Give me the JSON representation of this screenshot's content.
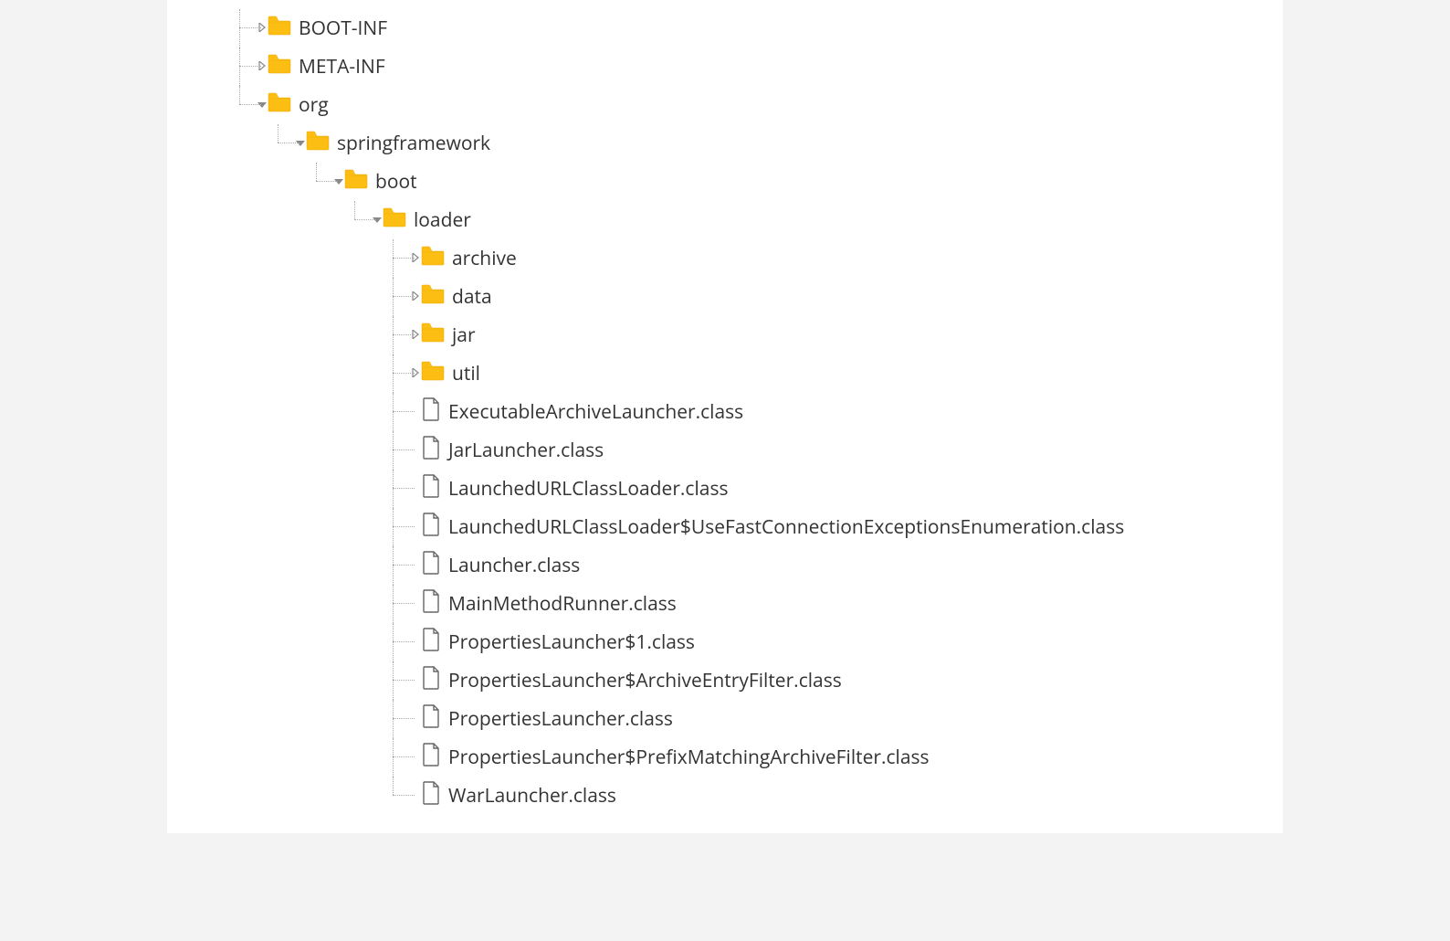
{
  "colors": {
    "folder": "#FDBE14",
    "folder_stroke": "#E8A800",
    "file_stroke": "#666666",
    "text": "#333333",
    "toggle": "#888888"
  },
  "tree": [
    {
      "label": "BOOT-INF",
      "type": "folder",
      "state": "collapsed"
    },
    {
      "label": "META-INF",
      "type": "folder",
      "state": "collapsed"
    },
    {
      "label": "org",
      "type": "folder",
      "state": "expanded",
      "children": [
        {
          "label": "springframework",
          "type": "folder",
          "state": "expanded",
          "children": [
            {
              "label": "boot",
              "type": "folder",
              "state": "expanded",
              "children": [
                {
                  "label": "loader",
                  "type": "folder",
                  "state": "expanded",
                  "children": [
                    {
                      "label": "archive",
                      "type": "folder",
                      "state": "collapsed"
                    },
                    {
                      "label": "data",
                      "type": "folder",
                      "state": "collapsed"
                    },
                    {
                      "label": "jar",
                      "type": "folder",
                      "state": "collapsed"
                    },
                    {
                      "label": "util",
                      "type": "folder",
                      "state": "collapsed"
                    },
                    {
                      "label": "ExecutableArchiveLauncher.class",
                      "type": "file"
                    },
                    {
                      "label": "JarLauncher.class",
                      "type": "file"
                    },
                    {
                      "label": "LaunchedURLClassLoader.class",
                      "type": "file"
                    },
                    {
                      "label": "LaunchedURLClassLoader$UseFastConnectionExceptionsEnumeration.class",
                      "type": "file"
                    },
                    {
                      "label": "Launcher.class",
                      "type": "file"
                    },
                    {
                      "label": "MainMethodRunner.class",
                      "type": "file"
                    },
                    {
                      "label": "PropertiesLauncher$1.class",
                      "type": "file"
                    },
                    {
                      "label": "PropertiesLauncher$ArchiveEntryFilter.class",
                      "type": "file"
                    },
                    {
                      "label": "PropertiesLauncher.class",
                      "type": "file"
                    },
                    {
                      "label": "PropertiesLauncher$PrefixMatchingArchiveFilter.class",
                      "type": "file"
                    },
                    {
                      "label": "WarLauncher.class",
                      "type": "file"
                    }
                  ]
                }
              ]
            }
          ]
        }
      ]
    }
  ]
}
